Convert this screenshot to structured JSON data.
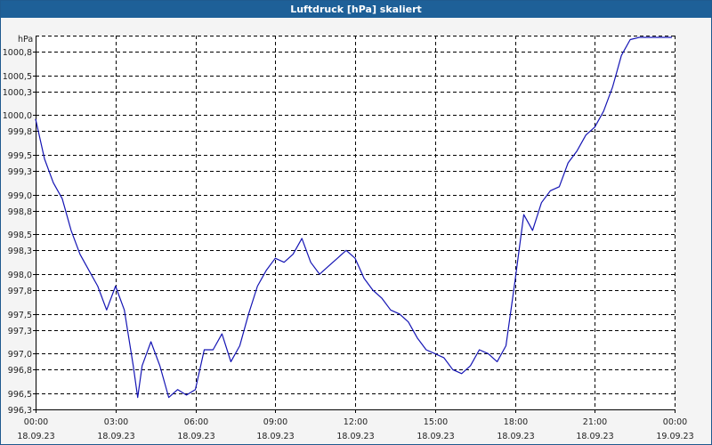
{
  "window": {
    "title": "Luftdruck [hPa] skaliert"
  },
  "chart_data": {
    "type": "line",
    "title": "Luftdruck [hPa] skaliert",
    "ylabel": "hPa",
    "xlabel": "",
    "ylim": [
      996.3,
      1001.0
    ],
    "grid": true,
    "line_color": "#1414b4",
    "x_ticks": [
      {
        "time": "00:00",
        "date": "18.09.23"
      },
      {
        "time": "03:00",
        "date": "18.09.23"
      },
      {
        "time": "06:00",
        "date": "18.09.23"
      },
      {
        "time": "09:00",
        "date": "18.09.23"
      },
      {
        "time": "12:00",
        "date": "18.09.23"
      },
      {
        "time": "15:00",
        "date": "18.09.23"
      },
      {
        "time": "18:00",
        "date": "18.09.23"
      },
      {
        "time": "21:00",
        "date": "18.09.23"
      },
      {
        "time": "00:00",
        "date": "19.09.23"
      }
    ],
    "y_ticks": [
      "996,3",
      "996,5",
      "996,8",
      "997,0",
      "997,3",
      "997,5",
      "997,8",
      "998,0",
      "998,3",
      "998,5",
      "998,8",
      "999,0",
      "999,3",
      "999,5",
      "999,8",
      "1000,0",
      "1000,3",
      "1000,5",
      "1000,8"
    ],
    "series": [
      {
        "x": [
          "18.09.23 00:00",
          "18.09.23 00:20",
          "18.09.23 00:40",
          "18.09.23 01:00",
          "18.09.23 01:20",
          "18.09.23 01:40",
          "18.09.23 02:00",
          "18.09.23 02:20",
          "18.09.23 02:40",
          "18.09.23 03:00",
          "18.09.23 03:20",
          "18.09.23 03:40",
          "18.09.23 03:50",
          "18.09.23 04:00",
          "18.09.23 04:20",
          "18.09.23 04:40",
          "18.09.23 05:00",
          "18.09.23 05:20",
          "18.09.23 05:40",
          "18.09.23 06:00",
          "18.09.23 06:20",
          "18.09.23 06:40",
          "18.09.23 07:00",
          "18.09.23 07:20",
          "18.09.23 07:40",
          "18.09.23 08:00",
          "18.09.23 08:20",
          "18.09.23 08:40",
          "18.09.23 09:00",
          "18.09.23 09:20",
          "18.09.23 09:40",
          "18.09.23 10:00",
          "18.09.23 10:20",
          "18.09.23 10:40",
          "18.09.23 11:00",
          "18.09.23 11:20",
          "18.09.23 11:40",
          "18.09.23 12:00",
          "18.09.23 12:20",
          "18.09.23 12:40",
          "18.09.23 13:00",
          "18.09.23 13:20",
          "18.09.23 13:40",
          "18.09.23 14:00",
          "18.09.23 14:20",
          "18.09.23 14:40",
          "18.09.23 15:00",
          "18.09.23 15:20",
          "18.09.23 15:40",
          "18.09.23 16:00",
          "18.09.23 16:20",
          "18.09.23 16:40",
          "18.09.23 17:00",
          "18.09.23 17:20",
          "18.09.23 17:40",
          "18.09.23 18:00",
          "18.09.23 18:20",
          "18.09.23 18:40",
          "18.09.23 19:00",
          "18.09.23 19:20",
          "18.09.23 19:40",
          "18.09.23 20:00",
          "18.09.23 20:20",
          "18.09.23 20:40",
          "18.09.23 21:00",
          "18.09.23 21:20",
          "18.09.23 21:40",
          "18.09.23 22:00",
          "18.09.23 22:20",
          "18.09.23 22:40",
          "18.09.23 23:00",
          "18.09.23 23:20",
          "18.09.23 23:40",
          "18.09.23 23:55"
        ],
        "y": [
          999.95,
          999.45,
          999.15,
          998.95,
          998.55,
          998.25,
          998.05,
          997.85,
          997.55,
          997.85,
          997.55,
          996.85,
          996.45,
          996.85,
          997.15,
          996.85,
          996.45,
          996.55,
          996.48,
          996.55,
          997.05,
          997.05,
          997.25,
          996.9,
          997.1,
          997.5,
          997.85,
          998.05,
          998.2,
          998.15,
          998.25,
          998.45,
          998.15,
          998.0,
          998.1,
          998.2,
          998.3,
          998.2,
          997.95,
          997.8,
          997.7,
          997.55,
          997.5,
          997.4,
          997.2,
          997.05,
          997.0,
          996.95,
          996.8,
          996.75,
          996.85,
          997.05,
          997.0,
          996.9,
          997.1,
          997.9,
          998.75,
          998.55,
          998.9,
          999.05,
          999.1,
          999.4,
          999.55,
          999.75,
          999.85,
          1000.05,
          1000.35,
          1000.75,
          1000.95,
          1001.1,
          1001.1,
          1001.1,
          1001.1,
          1001.1
        ]
      }
    ]
  }
}
